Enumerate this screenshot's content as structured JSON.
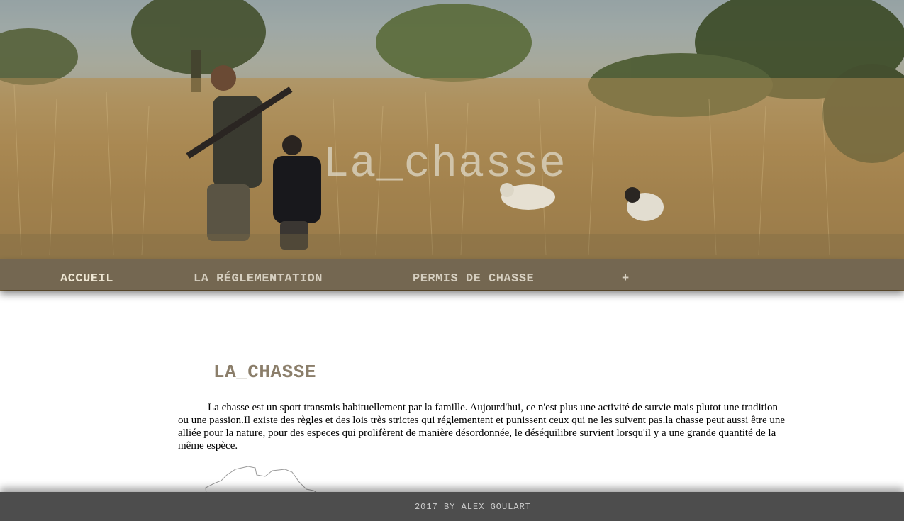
{
  "hero": {
    "title": "La_chasse",
    "image_description_icon": "hunting-field-photo"
  },
  "nav": {
    "items": [
      {
        "label": "ACCUEIL",
        "active": true
      },
      {
        "label": "LA RÉGLEMENTATION",
        "active": false
      },
      {
        "label": "PERMIS DE CHASSE",
        "active": false
      },
      {
        "label": "+",
        "active": false
      }
    ]
  },
  "main": {
    "heading": "LA_CHASSE",
    "paragraph": "La chasse est un sport transmis habituellement par la famille. Aujourd'hui, ce n'est plus une activité de survie mais plutot une tradition ou une passion.Il existe des règles et des lois très strictes qui réglementent et punissent ceux qui ne les suivent pas.la chasse peut aussi être une alliée pour la nature, pour des especes qui prolifèrent de manière désordonnée, le déséquilibre survient lorsqu'il y a une grande quantité de la même espèce."
  },
  "footer": {
    "text": "2017 BY ALEX GOULART"
  },
  "colors": {
    "nav_bg": "#6e6454",
    "heading": "#8b7e6a",
    "footer_bg": "#4d4d4d"
  }
}
